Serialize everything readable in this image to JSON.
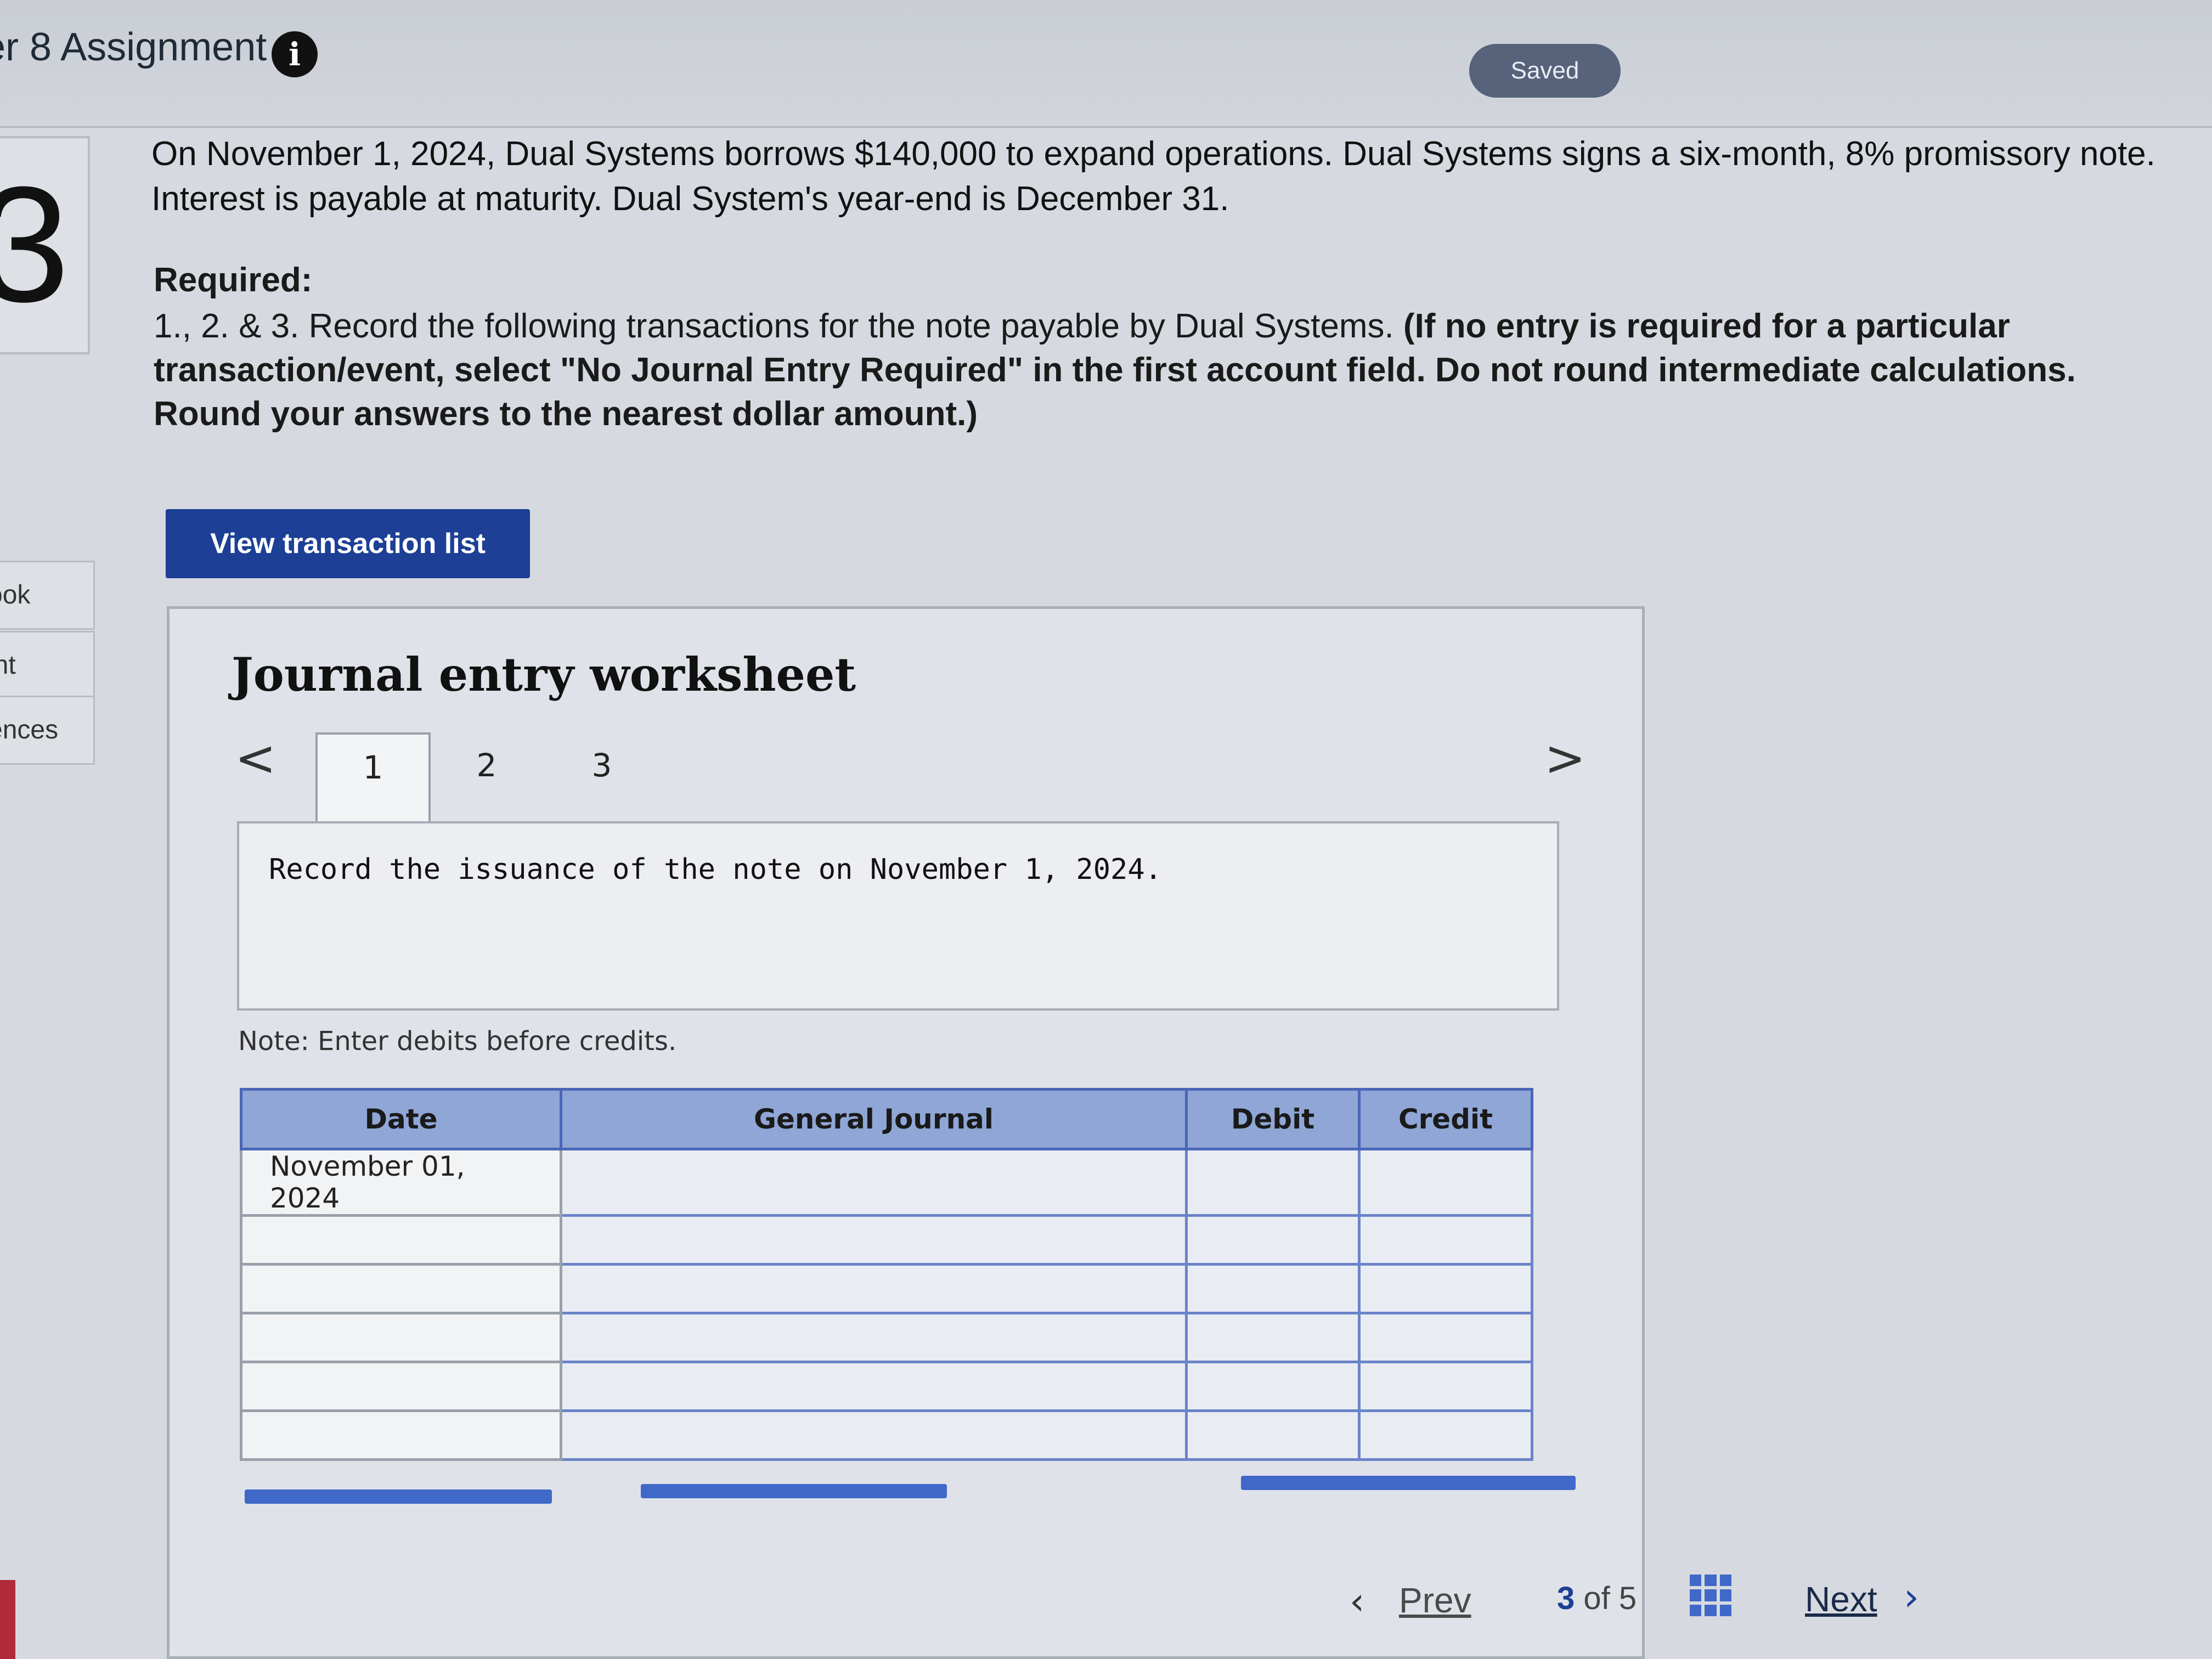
{
  "header": {
    "title": "er 8 Assignment",
    "info_icon": "i",
    "saved_label": "Saved"
  },
  "question": {
    "number": "3",
    "text": "On November 1, 2024, Dual Systems borrows $140,000 to expand operations. Dual Systems signs a six-month, 8% promissory note. Interest is payable at maturity. Dual System's year-end is December 31.",
    "required_label": "Required:",
    "instruction_prefix": "1., 2. & 3. Record the following transactions for the note payable by Dual Systems.",
    "instruction_bold": "(If no entry is required for a particular transaction/event, select \"No Journal Entry Required\" in the first account field. Do not round intermediate calculations. Round your answers to the nearest dollar amount.)"
  },
  "sidebar": {
    "items": [
      {
        "label": "ook"
      },
      {
        "label": "int"
      },
      {
        "label": "ences"
      }
    ]
  },
  "view_button": {
    "label": "View transaction list"
  },
  "worksheet": {
    "title": "Journal entry worksheet",
    "tabs": [
      "1",
      "2",
      "3"
    ],
    "active_tab": "1",
    "prev_icon": "<",
    "next_icon": ">",
    "description": "Record the issuance of the note on November 1, 2024.",
    "note": "Note: Enter debits before credits.",
    "table": {
      "headers": [
        "Date",
        "General Journal",
        "Debit",
        "Credit"
      ],
      "rows": [
        {
          "date": "November 01, 2024",
          "account": "",
          "debit": "",
          "credit": ""
        },
        {
          "date": "",
          "account": "",
          "debit": "",
          "credit": ""
        },
        {
          "date": "",
          "account": "",
          "debit": "",
          "credit": ""
        },
        {
          "date": "",
          "account": "",
          "debit": "",
          "credit": ""
        },
        {
          "date": "",
          "account": "",
          "debit": "",
          "credit": ""
        },
        {
          "date": "",
          "account": "",
          "debit": "",
          "credit": ""
        }
      ]
    }
  },
  "footer": {
    "prev_label": "Prev",
    "current_page": "3",
    "of_label": "of",
    "total_pages": "5",
    "next_label": "Next"
  },
  "colors": {
    "accent": "#1d3f96",
    "table_header": "#8fa6d6",
    "saved_pill": "#56637a"
  }
}
